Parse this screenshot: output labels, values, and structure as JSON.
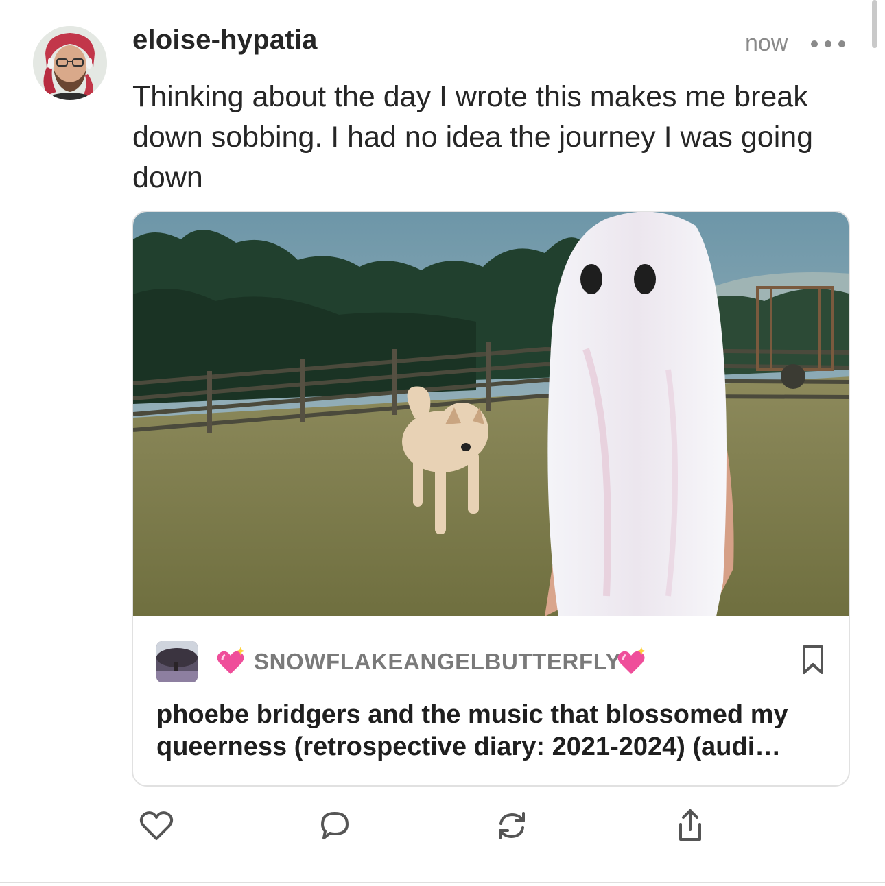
{
  "post": {
    "author": "eloise-hypatia",
    "timestamp": "now",
    "text": "Thinking about the day I wrote this makes me break down sobbing. I had no idea the journey I was going down"
  },
  "link_card": {
    "blog_name": "SNOWFLAKEANGELBUTTERFLY",
    "blog_name_decoration": "sparkling-heart-emoji",
    "title": "phoebe bridgers and the music that blossomed my queerness (retrospective diary: 2021-2024) (audi…"
  },
  "actions": [
    {
      "icon": "heart-icon"
    },
    {
      "icon": "comment-icon"
    },
    {
      "icon": "repost-icon"
    },
    {
      "icon": "share-icon"
    }
  ],
  "colors": {
    "text": "#262626",
    "muted": "#8a8a8a",
    "card_border": "#e1e1e1",
    "icon": "#555555"
  }
}
